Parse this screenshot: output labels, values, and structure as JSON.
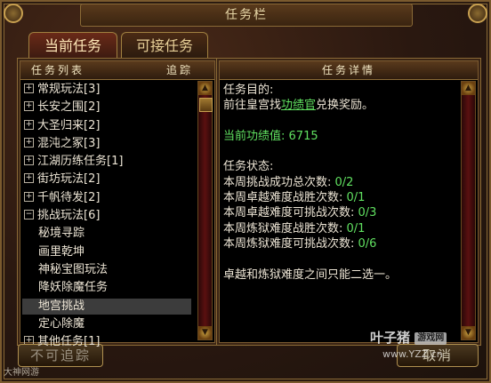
{
  "window": {
    "title": "任务栏"
  },
  "tabs": [
    {
      "label": "当前任务"
    },
    {
      "label": "可接任务"
    }
  ],
  "list_panel": {
    "header_title": "任务列表",
    "header_action": "追踪",
    "items": [
      {
        "label": "常规玩法[3]",
        "expander": "⊞"
      },
      {
        "label": "长安之围[2]",
        "expander": "⊞"
      },
      {
        "label": "大圣归来[2]",
        "expander": "⊞"
      },
      {
        "label": "混沌之冢[3]",
        "expander": "⊞"
      },
      {
        "label": "江湖历练任务[1]",
        "expander": "⊞"
      },
      {
        "label": "街坊玩法[2]",
        "expander": "⊞"
      },
      {
        "label": "千帆待发[2]",
        "expander": "⊞"
      },
      {
        "label": "挑战玩法[6]",
        "expander": "⊟"
      },
      {
        "label": "秘境寻踪"
      },
      {
        "label": "画里乾坤"
      },
      {
        "label": "神秘宝图玩法"
      },
      {
        "label": "降妖除魔任务"
      },
      {
        "label": "地宫挑战",
        "selected": true
      },
      {
        "label": "定心除魔"
      },
      {
        "label": "其他任务[1]",
        "expander": "⊞"
      }
    ]
  },
  "detail_panel": {
    "header_title": "任务详情",
    "goal_label": "任务目的:",
    "goal_prefix": "前往皇宫找",
    "goal_npc": "功绩官",
    "goal_suffix": "兑换奖励。",
    "merit_label": "当前功绩值:",
    "merit_value": "6715",
    "status_label": "任务状态:",
    "status_lines": [
      {
        "label": "本周挑战成功总次数:",
        "value": "0/2"
      },
      {
        "label": "本周卓越难度战胜次数:",
        "value": "0/1"
      },
      {
        "label": "本周卓越难度可挑战次数:",
        "value": "0/3"
      },
      {
        "label": "本周炼狱难度战胜次数:",
        "value": "0/1"
      },
      {
        "label": "本周炼狱难度可挑战次数:",
        "value": "0/6"
      }
    ],
    "note": "卓越和炼狱难度之间只能二选一。"
  },
  "buttons": {
    "untrack": "不可追踪",
    "cancel": "取消"
  },
  "watermark": {
    "bottom_left": "大神网游",
    "site_name": "叶子猪",
    "site_badge": "游戏网",
    "site_url": "www.YZZ.cn"
  },
  "colors": {
    "highlight_green": "#60e060",
    "body_text": "#ece4d4",
    "frame_gold": "#8a6a36"
  }
}
